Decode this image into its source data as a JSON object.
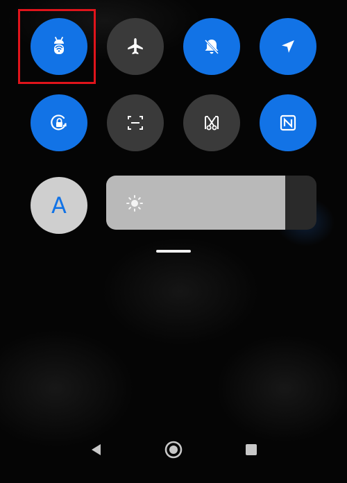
{
  "quick_settings": {
    "row1": [
      {
        "icon": "bug-wifi-icon",
        "state": "on"
      },
      {
        "icon": "airplane-icon",
        "state": "off"
      },
      {
        "icon": "bell-off-icon",
        "state": "on"
      },
      {
        "icon": "location-arrow-icon",
        "state": "on"
      }
    ],
    "row2": [
      {
        "icon": "rotation-lock-icon",
        "state": "on"
      },
      {
        "icon": "screenshot-icon",
        "state": "off"
      },
      {
        "icon": "scissors-icon",
        "state": "off"
      },
      {
        "icon": "nfc-icon",
        "state": "on"
      }
    ],
    "font_button": {
      "label": "A"
    },
    "brightness": {
      "level_percent": 85,
      "icon": "sun-icon"
    }
  },
  "colors": {
    "active_tile": "#1273e6",
    "inactive_tile": "#3a3a3a",
    "highlight_box": "#e0141b",
    "background": "#050505"
  },
  "nav_bar": {
    "items": [
      "back-icon",
      "home-icon",
      "recents-icon"
    ]
  }
}
